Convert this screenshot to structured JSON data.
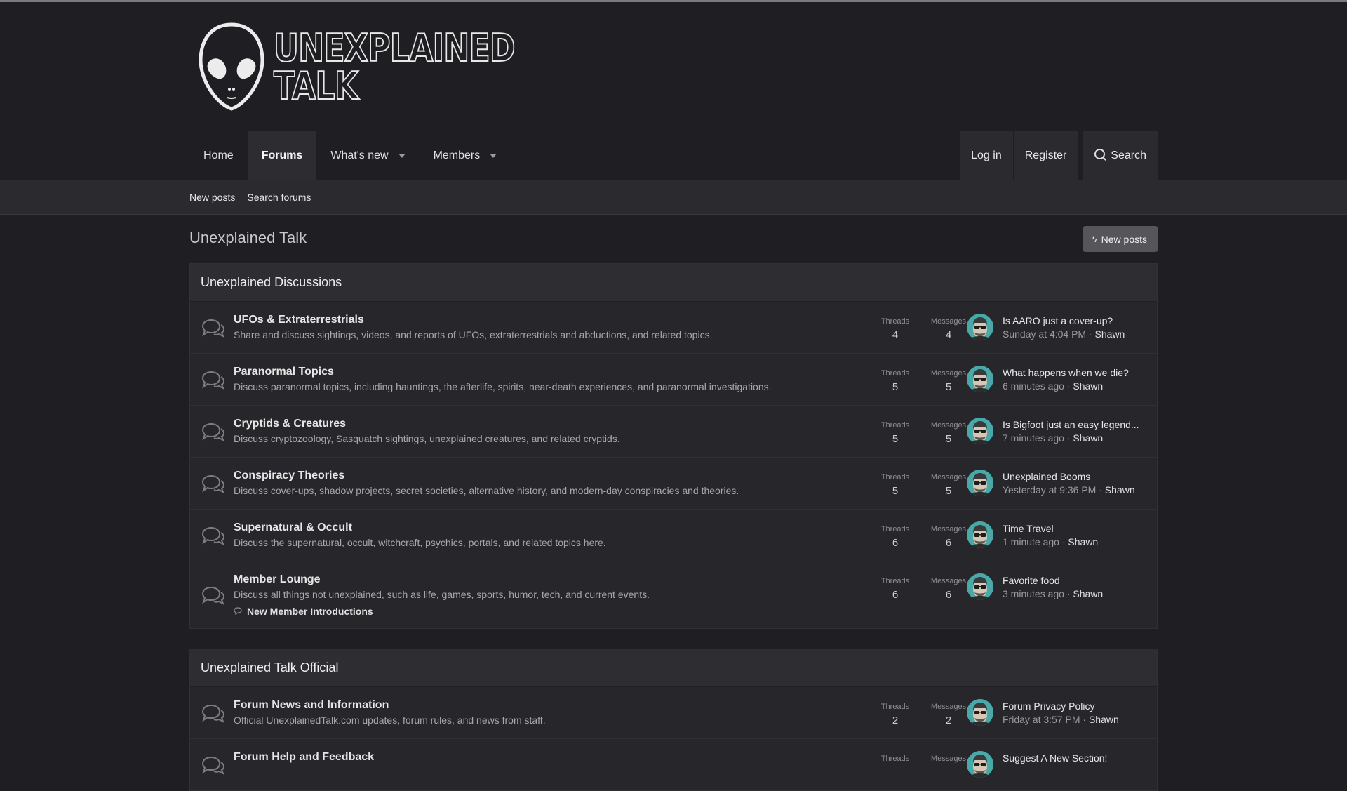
{
  "logo": {
    "line1": "UNEXPLAINED",
    "line2": "TALK"
  },
  "nav": {
    "tabs": [
      {
        "label": "Home"
      },
      {
        "label": "Forums"
      },
      {
        "label": "What's new"
      },
      {
        "label": "Members"
      }
    ],
    "login": "Log in",
    "register": "Register",
    "search": "Search"
  },
  "subnav": {
    "new_posts": "New posts",
    "search_forums": "Search forums"
  },
  "page": {
    "title": "Unexplained Talk",
    "new_posts_button": "New posts"
  },
  "labels": {
    "threads": "Threads",
    "messages": "Messages",
    "separator": "·"
  },
  "categories": [
    {
      "title": "Unexplained Discussions",
      "forums": [
        {
          "title": "UFOs & Extraterrestrials",
          "desc": "Share and discuss sightings, videos, and reports of UFOs, extraterrestrials and abductions, and related topics.",
          "threads": "4",
          "messages": "4",
          "last_title": "Is AARO just a cover-up?",
          "last_time": "Sunday at 4:04 PM",
          "last_user": "Shawn"
        },
        {
          "title": "Paranormal Topics",
          "desc": "Discuss paranormal topics, including hauntings, the afterlife, spirits, near-death experiences, and paranormal investigations.",
          "threads": "5",
          "messages": "5",
          "last_title": "What happens when we die?",
          "last_time": "6 minutes ago",
          "last_user": "Shawn"
        },
        {
          "title": "Cryptids & Creatures",
          "desc": "Discuss cryptozoology, Sasquatch sightings, unexplained creatures, and related cryptids.",
          "threads": "5",
          "messages": "5",
          "last_title": "Is Bigfoot just an easy legend...",
          "last_time": "7 minutes ago",
          "last_user": "Shawn"
        },
        {
          "title": "Conspiracy Theories",
          "desc": "Discuss cover-ups, shadow projects, secret societies, alternative history, and modern-day conspiracies and theories.",
          "threads": "5",
          "messages": "5",
          "last_title": "Unexplained Booms",
          "last_time": "Yesterday at 9:36 PM",
          "last_user": "Shawn"
        },
        {
          "title": "Supernatural & Occult",
          "desc": "Discuss the supernatural, occult, witchcraft, psychics, portals, and related topics here.",
          "threads": "6",
          "messages": "6",
          "last_title": "Time Travel",
          "last_time": "1 minute ago",
          "last_user": "Shawn"
        },
        {
          "title": "Member Lounge",
          "desc": "Discuss all things not unexplained, such as life, games, sports, humor, tech, and current events.",
          "subforum": "New Member Introductions",
          "threads": "6",
          "messages": "6",
          "last_title": "Favorite food",
          "last_time": "3 minutes ago",
          "last_user": "Shawn"
        }
      ]
    },
    {
      "title": "Unexplained Talk Official",
      "forums": [
        {
          "title": "Forum News and Information",
          "desc": "Official UnexplainedTalk.com updates, forum rules, and news from staff.",
          "threads": "2",
          "messages": "2",
          "last_title": "Forum Privacy Policy",
          "last_time": "Friday at 3:57 PM",
          "last_user": "Shawn"
        },
        {
          "title": "Forum Help and Feedback",
          "desc": "",
          "threads": "",
          "messages": "",
          "last_title": "Suggest A New Section!",
          "last_time": "",
          "last_user": ""
        }
      ]
    }
  ]
}
